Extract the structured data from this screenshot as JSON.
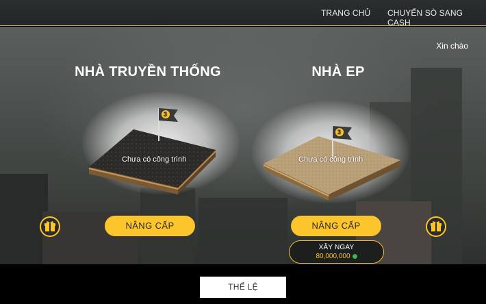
{
  "nav": {
    "home_label": "TRANG CHỦ",
    "cash_label": "CHUYỂN SÒ SANG CASH"
  },
  "greeting": "Xin chào",
  "houses": [
    {
      "title": "NHÀ TRUYỀN THỐNG",
      "plot_label": "Chưa có công trình",
      "flag_number": "3",
      "upgrade_label": "NÂNG CẤP"
    },
    {
      "title": "NHÀ EP",
      "plot_label": "Chưa có công trình",
      "flag_number": "3",
      "upgrade_label": "NÂNG CẤP",
      "build_now_label": "XÂY NGAY",
      "build_price": "80,000,000"
    }
  ],
  "icons": {
    "gift_left": "gift-icon",
    "gift_right": "gift-icon",
    "coin": "coin-icon",
    "flag": "flag-icon"
  },
  "rules_label": "THỂ LỆ",
  "colors": {
    "accent": "#fcc52c",
    "topbar": "#282b2c",
    "soil_dark": "#2f2d2b",
    "soil_sand": "#b49b74"
  }
}
